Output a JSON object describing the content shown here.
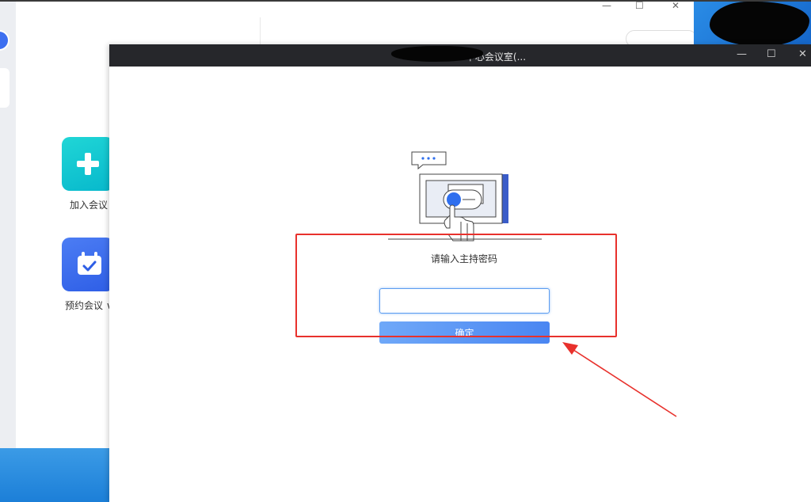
{
  "background_app": {
    "window_controls": {
      "minimize": "—",
      "maximize": "☐",
      "close": "✕"
    },
    "join_meeting_label": "加入会议",
    "schedule_meeting_label": "预约会议 ∨",
    "banner_color": "#1f7ee0"
  },
  "dialog": {
    "title": "中心会议室(...",
    "window_controls": {
      "minimize": "—",
      "maximize": "☐",
      "close": "✕"
    },
    "prompt": "请输入主持密码",
    "password_value": "",
    "confirm_label": "确定",
    "accent_color": "#4a86f2"
  },
  "annotation": {
    "color": "#e8312c"
  }
}
